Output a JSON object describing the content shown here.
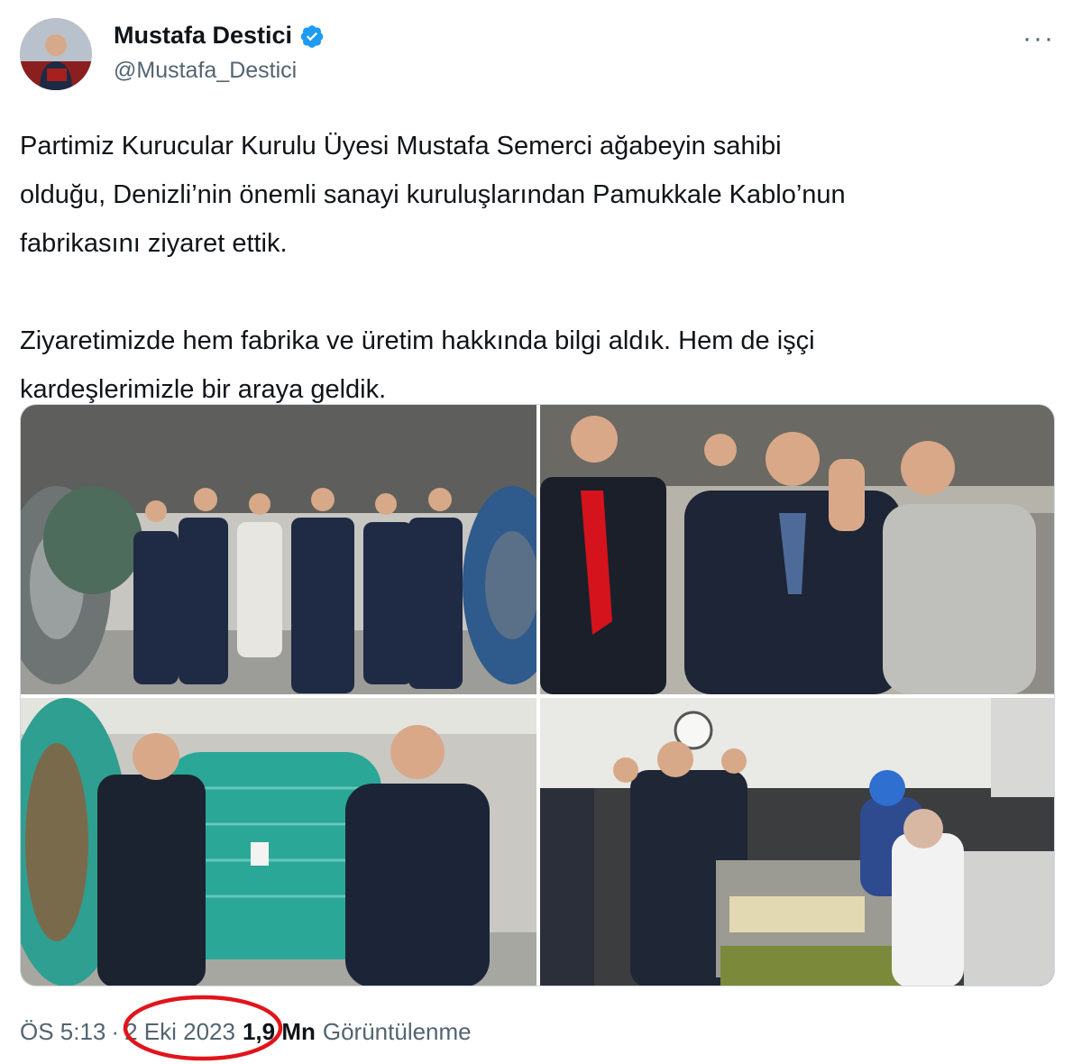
{
  "author": {
    "display_name": "Mustafa Destici",
    "handle": "@Mustafa_Destici",
    "verified_icon": "verified-badge-icon",
    "more_label": "···"
  },
  "tweet": {
    "text": "Partimiz Kurucular Kurulu Üyesi Mustafa Semerci ağabeyin sahibi\nolduğu, Denizli’nin önemli sanayi kuruluşlarından Pamukkale Kablo’nun\nfabrikasını ziyaret ettik.\n\nZiyaretimizde hem fabrika ve üretim hakkında bilgi aldık. Hem de işçi\nkardeşlerimizle bir araya geldik."
  },
  "meta": {
    "time": "ÖS 5:13",
    "separator": "·",
    "date": "2 Eki 2023",
    "views_count": "1,9 Mn",
    "views_label": "Görüntülenme"
  },
  "colors": {
    "text": "#0f1419",
    "secondary": "#536471",
    "verified": "#1d9bf0",
    "annotation_circle": "#e0151b"
  }
}
